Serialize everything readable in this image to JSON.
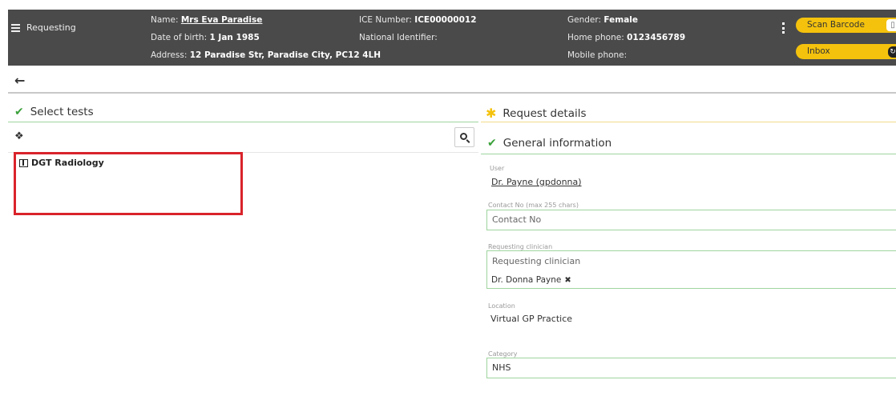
{
  "header": {
    "menu_label": "Requesting",
    "name_label": "Name:",
    "name_value": "Mrs Eva Paradise",
    "dob_label": "Date of birth:",
    "dob_value": "1 Jan 1985",
    "address_label": "Address:",
    "address_value": "12 Paradise Str, Paradise City, PC12 4LH",
    "ice_label": "ICE Number:",
    "ice_value": "ICE00000012",
    "national_id_label": "National Identifier:",
    "gender_label": "Gender:",
    "gender_value": "Female",
    "home_phone_label": "Home phone:",
    "home_phone_value": "0123456789",
    "mobile_phone_label": "Mobile phone:",
    "scan_barcode_label": "Scan Barcode",
    "inbox_label": "Inbox"
  },
  "left": {
    "title": "Select tests",
    "tree_items": [
      {
        "label": "DGT Radiology"
      }
    ]
  },
  "right": {
    "request_details_title": "Request details",
    "general_info_title": "General information",
    "user_label": "User",
    "user_value": "Dr. Payne (gpdonna)",
    "contact_label": "Contact No (max 255 chars)",
    "contact_placeholder": "Contact No",
    "clinician_label": "Requesting clinician",
    "clinician_placeholder": "Requesting clinician",
    "clinician_selected": "Dr. Donna Payne",
    "location_label": "Location",
    "location_value": "Virtual GP Practice",
    "category_label": "Category",
    "category_value": "NHS"
  },
  "icons": {
    "menu": "hamburger-icon",
    "back": "arrow-left-icon",
    "home": "home-icon",
    "search": "search-icon",
    "check": "checkmark-icon",
    "star": "asterisk-icon",
    "book": "book-icon",
    "remove": "close-icon"
  },
  "colors": {
    "header_bg": "#4a4a4a",
    "accent_yellow": "#f4c20d",
    "success_green": "#3aa13a",
    "highlight_red": "#d9232b"
  }
}
